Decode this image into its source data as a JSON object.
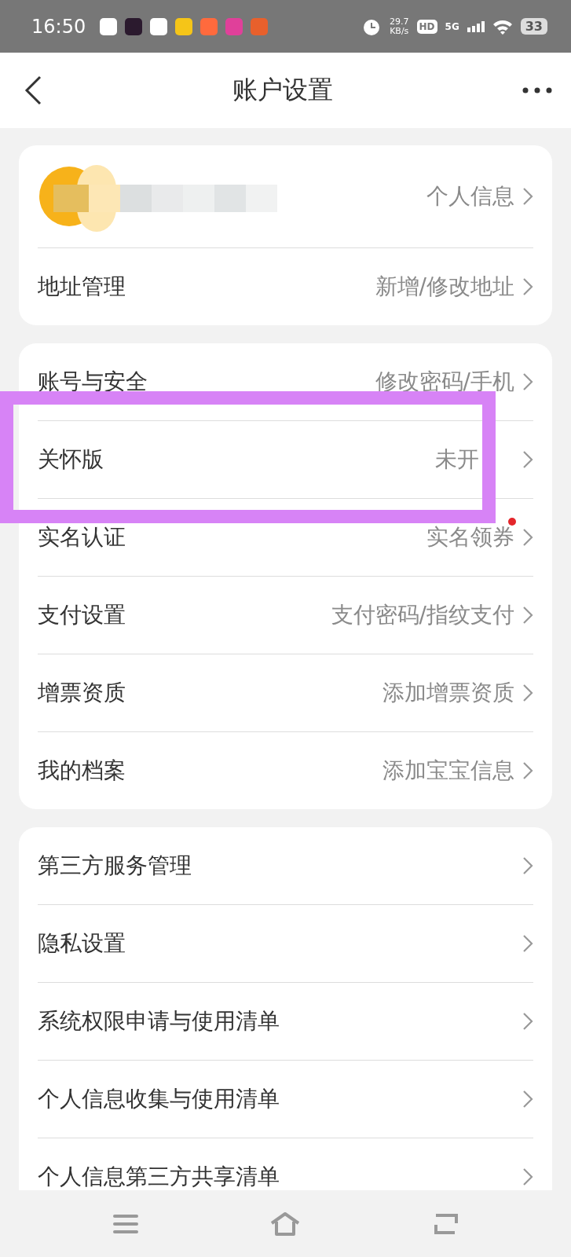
{
  "status_bar": {
    "time": "16:50",
    "apps": [
      {
        "color": "#ffffff"
      },
      {
        "color": "#2b1a2e"
      },
      {
        "color": "#ffffff"
      },
      {
        "color": "#f5c518"
      },
      {
        "color": "#ff6a3d"
      },
      {
        "color": "#e0409a"
      },
      {
        "color": "#e8602c"
      }
    ],
    "speed_value": "29.7",
    "speed_unit": "KB/s",
    "hd": "HD",
    "network": "5G",
    "battery": "33"
  },
  "header": {
    "title": "账户设置"
  },
  "groups": [
    {
      "rows": [
        {
          "kind": "profile",
          "value": "个人信息"
        },
        {
          "kind": "row",
          "label": "地址管理",
          "value": "新增/修改地址"
        }
      ]
    },
    {
      "rows": [
        {
          "kind": "row",
          "label": "账号与安全",
          "value": "修改密码/手机"
        },
        {
          "kind": "row",
          "label": "关怀版",
          "value": "未开",
          "highlighted": true
        },
        {
          "kind": "row",
          "label": "实名认证",
          "value": "实名领券",
          "dot": true
        },
        {
          "kind": "row",
          "label": "支付设置",
          "value": "支付密码/指纹支付"
        },
        {
          "kind": "row",
          "label": "增票资质",
          "value": "添加增票资质"
        },
        {
          "kind": "row",
          "label": "我的档案",
          "value": "添加宝宝信息"
        }
      ]
    },
    {
      "rows": [
        {
          "kind": "row",
          "label": "第三方服务管理"
        },
        {
          "kind": "row",
          "label": "隐私设置"
        },
        {
          "kind": "row",
          "label": "系统权限申请与使用清单"
        },
        {
          "kind": "row",
          "label": "个人信息收集与使用清单"
        },
        {
          "kind": "row",
          "label": "个人信息第三方共享清单"
        }
      ]
    }
  ]
}
